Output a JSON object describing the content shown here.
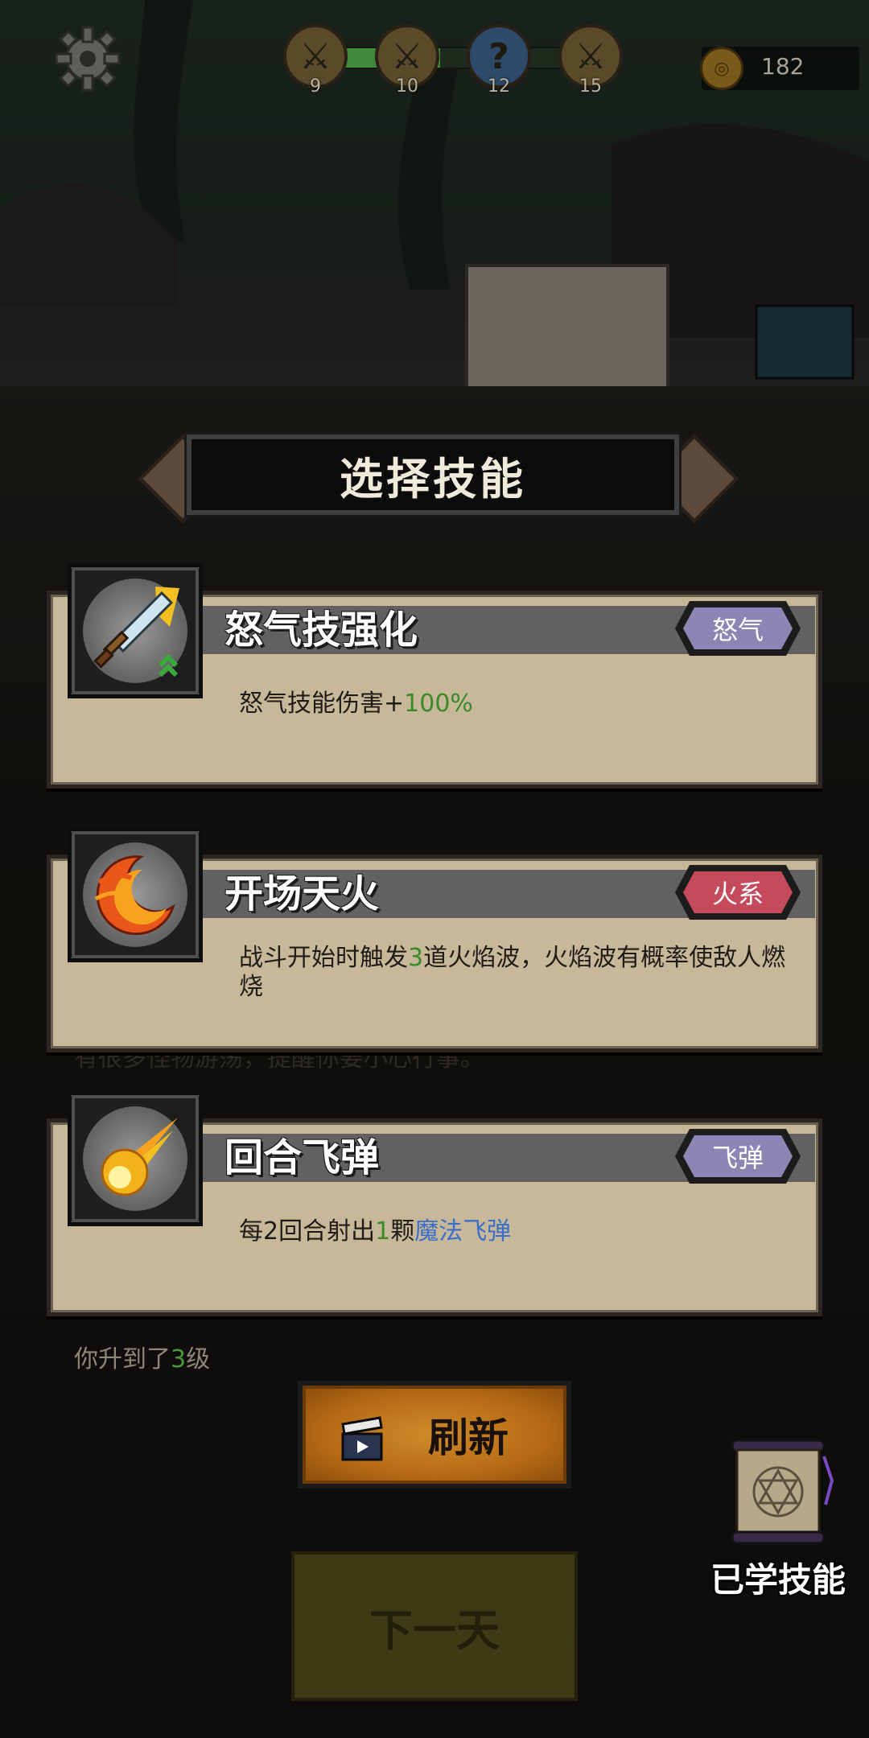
{
  "hud": {
    "stages": [
      {
        "num": "9",
        "icon": "crossed-swords-icon"
      },
      {
        "num": "10",
        "icon": "crossed-swords-icon"
      },
      {
        "num": "12",
        "icon": "question-mark-icon",
        "glyph": "?"
      },
      {
        "num": "15",
        "icon": "crossed-swords-icon"
      }
    ],
    "stage_progress": 0.45,
    "coins": "182"
  },
  "title": "选择技能",
  "skills": [
    {
      "name": "怒气技强化",
      "tag": "怒气",
      "tag_color": "#8c86b4",
      "icon": "sword-upgrade-icon",
      "desc_parts": [
        "怒气技能伤害+",
        "100%"
      ]
    },
    {
      "name": "开场天火",
      "tag": "火系",
      "tag_color": "#c44a5c",
      "icon": "fire-crescent-icon",
      "desc_parts": [
        "战斗开始时触发",
        "3",
        "道火焰波，火焰波有概率使敌人燃烧"
      ]
    },
    {
      "name": "回合飞弹",
      "tag": "飞弹",
      "tag_color": "#8c86b4",
      "icon": "fireball-icon",
      "desc_parts": [
        "每2回合射出",
        "1",
        "颗",
        "魔法飞弹"
      ]
    }
  ],
  "log": {
    "background_text": "有很多怪物游荡，提醒你要小心行事。",
    "levelup_parts": [
      "你升到了",
      "3",
      "级"
    ]
  },
  "buttons": {
    "refresh": "刷新",
    "next_day": "下一天",
    "learned_skills": "已学技能"
  },
  "colors": {
    "card_bg": "#c8b89a",
    "highlight_green": "#3a8a2a",
    "highlight_blue": "#3a6ec8",
    "refresh_orange": "#d08a2a"
  }
}
